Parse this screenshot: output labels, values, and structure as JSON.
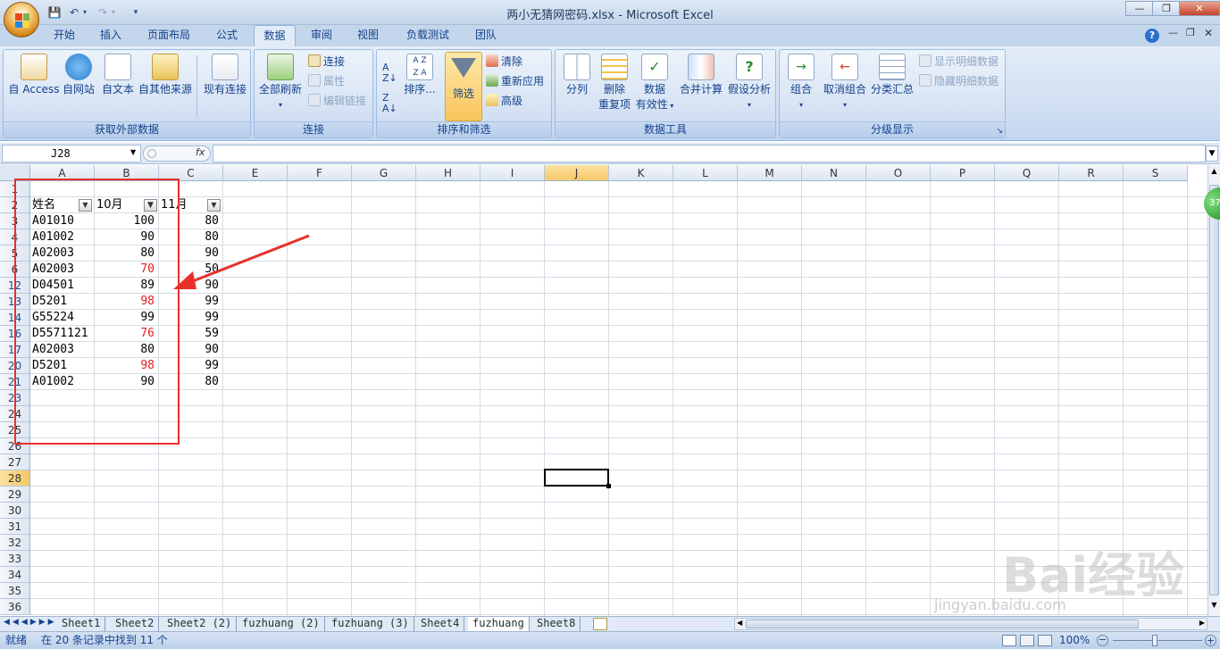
{
  "window": {
    "title": "两小无猜网密码.xlsx - Microsoft Excel"
  },
  "tabs": [
    "开始",
    "插入",
    "页面布局",
    "公式",
    "数据",
    "审阅",
    "视图",
    "负载测试",
    "团队"
  ],
  "active_tab": "数据",
  "ribbon": {
    "get_external": {
      "label": "获取外部数据",
      "access": "自 Access",
      "web": "自网站",
      "text": "自文本",
      "other": "自其他来源",
      "existing": "现有连接"
    },
    "connections": {
      "label": "连接",
      "refresh_all": "全部刷新",
      "connections": "连接",
      "properties": "属性",
      "edit_links": "编辑链接"
    },
    "sort_filter": {
      "label": "排序和筛选",
      "sort": "排序...",
      "filter": "筛选",
      "clear": "清除",
      "reapply": "重新应用",
      "advanced": "高级"
    },
    "data_tools": {
      "label": "数据工具",
      "text_to_cols": "分列",
      "remove_dup_1": "删除",
      "remove_dup_2": "重复项",
      "validation_1": "数据",
      "validation_2": "有效性",
      "consolidate": "合并计算",
      "what_if": "假设分析"
    },
    "outline": {
      "label": "分级显示",
      "group": "组合",
      "ungroup": "取消组合",
      "subtotal": "分类汇总",
      "show_detail": "显示明细数据",
      "hide_detail": "隐藏明细数据"
    }
  },
  "formula_bar": {
    "name_box": "J28",
    "fx": "fx",
    "formula": ""
  },
  "columns": [
    "A",
    "B",
    "C",
    "E",
    "F",
    "G",
    "H",
    "I",
    "J",
    "K",
    "L",
    "M",
    "N",
    "O",
    "P",
    "Q",
    "R",
    "S"
  ],
  "header_row": {
    "row": "2",
    "a": "姓名",
    "b": "10月",
    "c": "11月"
  },
  "rows": [
    {
      "row": "3",
      "a": "A01010",
      "b": "100",
      "c": "80",
      "red": false
    },
    {
      "row": "4",
      "a": "A01002",
      "b": "90",
      "c": "80",
      "red": false
    },
    {
      "row": "5",
      "a": "A02003",
      "b": "80",
      "c": "90",
      "red": false
    },
    {
      "row": "6",
      "a": "A02003",
      "b": "70",
      "c": "50",
      "red": true
    },
    {
      "row": "12",
      "a": "D04501",
      "b": "89",
      "c": "90",
      "red": false
    },
    {
      "row": "13",
      "a": "D5201",
      "b": "98",
      "c": "99",
      "red": true
    },
    {
      "row": "14",
      "a": "G55224",
      "b": "99",
      "c": "99",
      "red": false
    },
    {
      "row": "16",
      "a": "D5571121",
      "b": "76",
      "c": "59",
      "red": true
    },
    {
      "row": "17",
      "a": "A02003",
      "b": "80",
      "c": "90",
      "red": false
    },
    {
      "row": "20",
      "a": "D5201",
      "b": "98",
      "c": "99",
      "red": true
    },
    {
      "row": "21",
      "a": "A01002",
      "b": "90",
      "c": "80",
      "red": false
    }
  ],
  "row_labels": [
    "1",
    "2",
    "3",
    "4",
    "5",
    "6",
    "12",
    "13",
    "14",
    "16",
    "17",
    "20",
    "21",
    "23",
    "24",
    "25",
    "26",
    "27",
    "28",
    "29",
    "30",
    "31",
    "32",
    "33",
    "34",
    "35",
    "36"
  ],
  "sheets": [
    "Sheet1",
    "Sheet2",
    "Sheet2 (2)",
    "fuzhuang (2)",
    "fuzhuang (3)",
    "Sheet4",
    "fuzhuang",
    "Sheet8"
  ],
  "active_sheet": "fuzhuang",
  "status": {
    "ready": "就绪",
    "message": "在 20 条记录中找到 11 个",
    "zoom": "100%"
  },
  "watermark": {
    "main": "Bai经验",
    "sub": "jingyan.baidu.com"
  },
  "side_badge": "37"
}
